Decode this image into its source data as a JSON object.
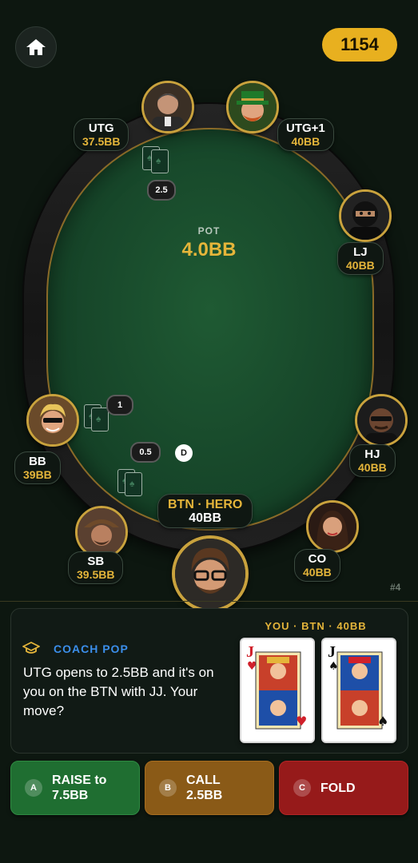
{
  "header": {
    "home_icon": "home-icon",
    "coins": "1154"
  },
  "table": {
    "pot_label": "POT",
    "pot_value": "4.0BB",
    "hand_number": "#4",
    "bets": {
      "utg": "2.5",
      "bb": "1",
      "sb": "0.5"
    },
    "dealer_label": "D"
  },
  "players": {
    "utg": {
      "position": "UTG",
      "stack": "37.5BB"
    },
    "utg1": {
      "position": "UTG+1",
      "stack": "40BB"
    },
    "lj": {
      "position": "LJ",
      "stack": "40BB"
    },
    "hj": {
      "position": "HJ",
      "stack": "40BB"
    },
    "co": {
      "position": "CO",
      "stack": "40BB"
    },
    "hero": {
      "position": "BTN · HERO",
      "stack": "40BB"
    },
    "sb": {
      "position": "SB",
      "stack": "39.5BB"
    },
    "bb": {
      "position": "BB",
      "stack": "39BB"
    }
  },
  "coach": {
    "title": "COACH POP",
    "icon": "graduation-cap-icon",
    "message": "UTG opens to 2.5BB and it's on you on the BTN with JJ. Your move?",
    "hero_label": "YOU · BTN · 40BB",
    "cards": [
      {
        "rank": "J",
        "suit": "hearts",
        "color": "#d0202a"
      },
      {
        "rank": "J",
        "suit": "spades",
        "color": "#111111"
      }
    ]
  },
  "actions": [
    {
      "key": "A",
      "label_line1": "RAISE to",
      "label_line2": "7.5BB",
      "color": "#1f6e31"
    },
    {
      "key": "B",
      "label_line1": "CALL",
      "label_line2": "2.5BB",
      "color": "#8a5a17"
    },
    {
      "key": "C",
      "label_line1": "FOLD",
      "label_line2": "",
      "color": "#961a1a"
    }
  ]
}
